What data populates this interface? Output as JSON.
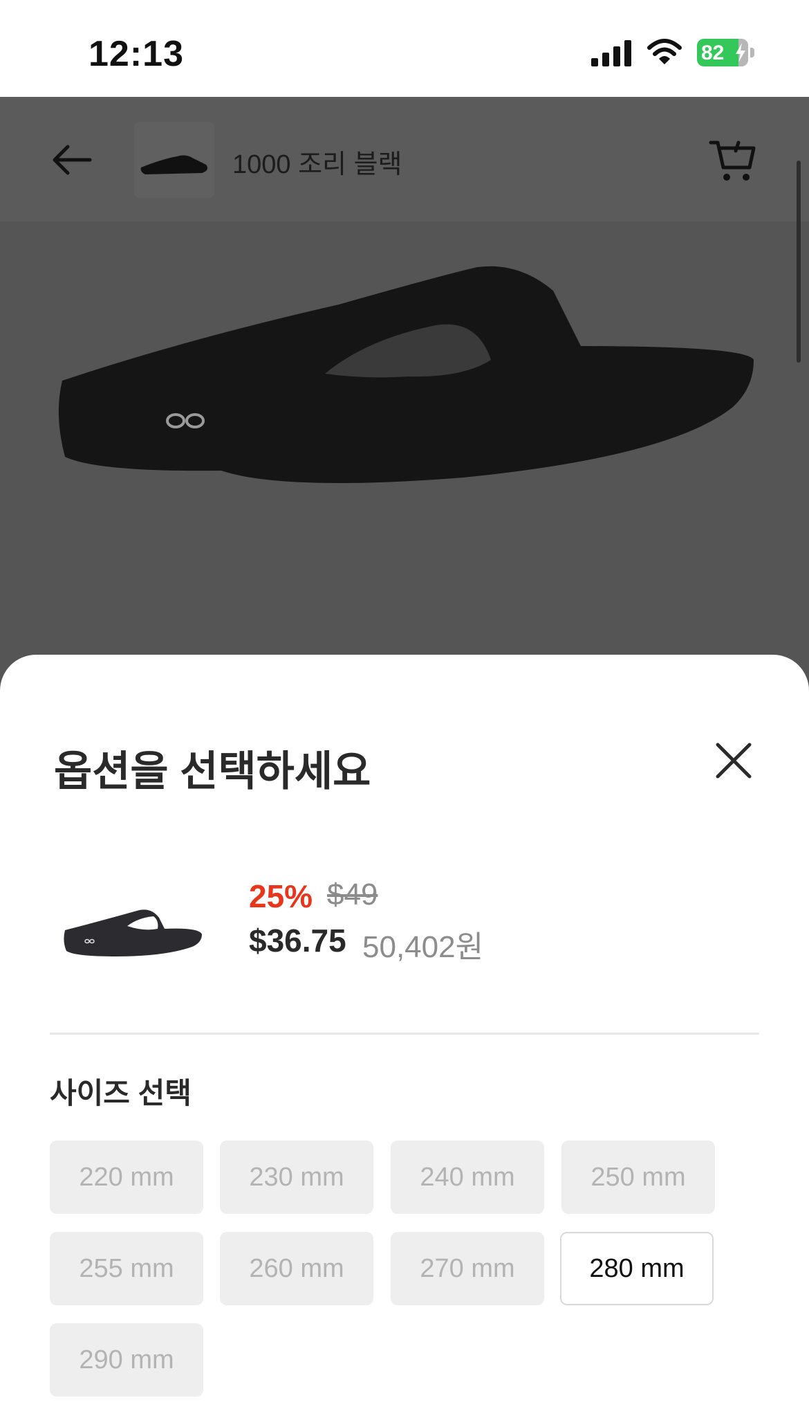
{
  "status_bar": {
    "time": "12:13",
    "battery": "82"
  },
  "header": {
    "product_title": "1000 조리 블랙"
  },
  "sheet": {
    "title": "옵션을 선택하세요",
    "discount": "25%",
    "original_price": "$49",
    "sale_price": "$36.75",
    "krw_price": "50,402원",
    "size_heading": "사이즈 선택",
    "sizes": [
      {
        "label": "220 mm",
        "selected": false
      },
      {
        "label": "230 mm",
        "selected": false
      },
      {
        "label": "240 mm",
        "selected": false
      },
      {
        "label": "250 mm",
        "selected": false
      },
      {
        "label": "255 mm",
        "selected": false
      },
      {
        "label": "260 mm",
        "selected": false
      },
      {
        "label": "270 mm",
        "selected": false
      },
      {
        "label": "280 mm",
        "selected": true
      },
      {
        "label": "290 mm",
        "selected": false
      }
    ]
  },
  "colors": {
    "accent_red": "#e8361d",
    "battery_green": "#34c759"
  },
  "icons": [
    "signal-icon",
    "wifi-icon",
    "battery-icon",
    "back-arrow-icon",
    "cart-icon",
    "close-icon"
  ]
}
